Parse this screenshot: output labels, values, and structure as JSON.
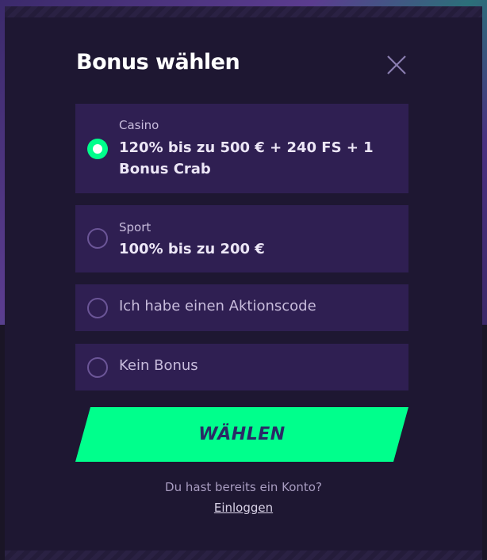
{
  "modal": {
    "title": "Bonus wählen",
    "close_icon": "close-icon"
  },
  "options": {
    "casino": {
      "label": "Casino",
      "value": "120% bis zu 500 € + 240 FS + 1 Bonus Crab",
      "selected": true
    },
    "sport": {
      "label": "Sport",
      "value": "100% bis zu 200 €",
      "selected": false
    },
    "promo_code": {
      "label": "Ich habe einen Aktionscode",
      "selected": false
    },
    "no_bonus": {
      "label": "Kein Bonus",
      "selected": false
    }
  },
  "cta": {
    "label": "WÄHLEN"
  },
  "footer": {
    "account_prompt": "Du hast bereits ein Konto?",
    "login_label": "Einloggen"
  },
  "colors": {
    "modal_bg": "#1e1732",
    "option_bg": "#2f1f52",
    "accent_green": "#00ff8c",
    "cta_text": "#2a2a66"
  }
}
